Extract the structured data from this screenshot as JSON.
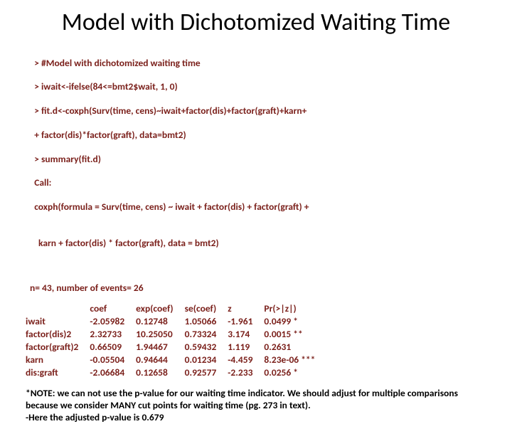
{
  "title": "Model with Dichotomized Waiting Time",
  "code": {
    "l1": "> #Model with dichotomized waiting time",
    "l2": "> iwait<-ifelse(84<=bmt2$wait, 1, 0)",
    "l3": "> fit.d<-coxph(Surv(time, cens)~iwait+factor(dis)+factor(graft)+karn+",
    "l4": "+ factor(dis)*factor(graft), data=bmt2)",
    "l5": "> summary(fit.d)",
    "l6": "Call:",
    "l7": "coxph(formula = Surv(time, cens) ~ iwait + factor(dis) + factor(graft) +",
    "l8": "karn + factor(dis) * factor(graft), data = bmt2)"
  },
  "stats_line": "n= 43, number of events= 26",
  "table": {
    "headers": [
      "",
      "coef",
      "exp(coef)",
      "se(coef)",
      "z",
      "Pr(>|z|)"
    ],
    "rows": [
      [
        "iwait",
        "-2.05982",
        "0.12748",
        "1.05066",
        "-1.961",
        "0.0499 *"
      ],
      [
        "factor(dis)2",
        " 2.32733",
        "10.25050",
        "0.73324",
        " 3.174",
        "0.0015 **"
      ],
      [
        "factor(graft)2",
        " 0.66509",
        "1.94467",
        "0.59432",
        " 1.119",
        "0.2631"
      ],
      [
        "karn",
        "-0.05504",
        "0.94644",
        "0.01234",
        "-4.459",
        "8.23e-06 ***"
      ],
      [
        "dis:graft",
        "-2.06684",
        "0.12658",
        "0.92577",
        "-2.233",
        "0.0256 *"
      ]
    ]
  },
  "note": {
    "l1": "*NOTE: we can not use the p-value for our waiting time indicator.  We should adjust for multiple comparisons because we consider MANY cut points for waiting time (pg. 273 in text).",
    "l2": "-Here the adjusted p-value is 0.679"
  }
}
